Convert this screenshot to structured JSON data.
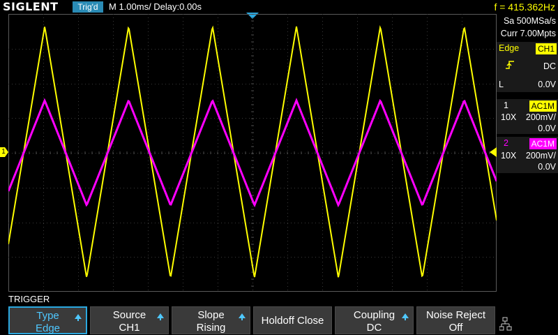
{
  "topbar": {
    "brand": "SIGLENT",
    "trigger_status": "Trig'd",
    "timebase": "M 1.00ms/ Delay:0.00s",
    "frequency": "f = 415.362Hz"
  },
  "panel": {
    "sample_rate": "Sa 500MSa/s",
    "memory_depth": "Curr 7.00Mpts",
    "trigger_type_label": "Edge",
    "trigger_source": "CH1",
    "trigger_coupling": "DC",
    "trigger_level_label": "L",
    "trigger_level": "0.0V",
    "ch1": {
      "number": "1",
      "coupling": "AC1M",
      "probe": "10X",
      "scale": "200mV/",
      "offset": "0.0V"
    },
    "ch2": {
      "number": "2",
      "coupling": "AC1M",
      "probe": "10X",
      "scale": "200mV/",
      "offset": "0.0V"
    }
  },
  "markers": {
    "ch1_ground": "1"
  },
  "menu": {
    "title": "TRIGGER",
    "buttons": [
      {
        "line1": "Type",
        "line2": "Edge"
      },
      {
        "line1": "Source",
        "line2": "CH1"
      },
      {
        "line1": "Slope",
        "line2": "Rising"
      },
      {
        "label": "Holdoff Close"
      },
      {
        "line1": "Coupling",
        "line2": "DC"
      },
      {
        "line1": "Noise Reject",
        "line2": "Off"
      }
    ]
  },
  "colors": {
    "ch1": "#ffff00",
    "ch2": "#ff00ff",
    "accent": "#2aa8e0"
  },
  "icons": {
    "network": "network-icon",
    "trigger_edge": "rising-edge-icon"
  }
}
